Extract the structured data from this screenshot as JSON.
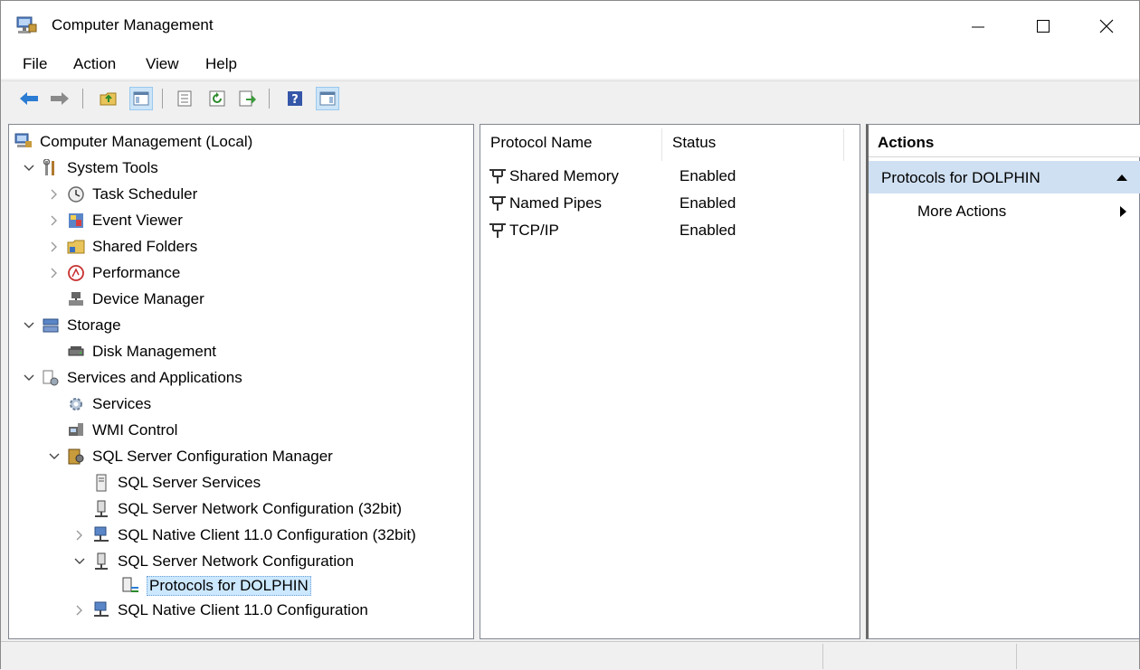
{
  "window": {
    "title": "Computer Management"
  },
  "window_controls": {
    "minimize": "—",
    "maximize": "☐",
    "close": "✕"
  },
  "menu": [
    "File",
    "Action",
    "View",
    "Help"
  ],
  "toolbar": {
    "buttons": [
      "back-icon",
      "forward-icon",
      "up-folder-icon",
      "show-hide-tree-icon",
      "properties-icon",
      "refresh-icon",
      "export-list-icon",
      "help-icon",
      "show-hide-action-pane-icon"
    ]
  },
  "tree": {
    "root": "Computer Management (Local)",
    "system_tools": "System Tools",
    "task_scheduler": "Task Scheduler",
    "event_viewer": "Event Viewer",
    "shared_folders": "Shared Folders",
    "performance": "Performance",
    "device_manager": "Device Manager",
    "storage": "Storage",
    "disk_management": "Disk Management",
    "services_apps": "Services and Applications",
    "services": "Services",
    "wmi_control": "WMI Control",
    "sql_config_manager": "SQL Server Configuration Manager",
    "sql_services": "SQL Server Services",
    "sql_net_config_32": "SQL Server Network Configuration (32bit)",
    "sql_native_client_32": "SQL Native Client 11.0 Configuration (32bit)",
    "sql_net_config": "SQL Server Network Configuration",
    "protocols_dolphin": "Protocols for DOLPHIN",
    "sql_native_client": "SQL Native Client 11.0 Configuration"
  },
  "list": {
    "columns": [
      "Protocol Name",
      "Status"
    ],
    "rows": [
      {
        "name": "Shared Memory",
        "status": "Enabled"
      },
      {
        "name": "Named Pipes",
        "status": "Enabled"
      },
      {
        "name": "TCP/IP",
        "status": "Enabled"
      }
    ]
  },
  "actions": {
    "header": "Actions",
    "section": "Protocols for DOLPHIN",
    "more": "More Actions"
  },
  "colors": {
    "selection": "#cce8ff",
    "actions_section": "#cfe0f2",
    "accent_blue": "#2b7cd3"
  }
}
